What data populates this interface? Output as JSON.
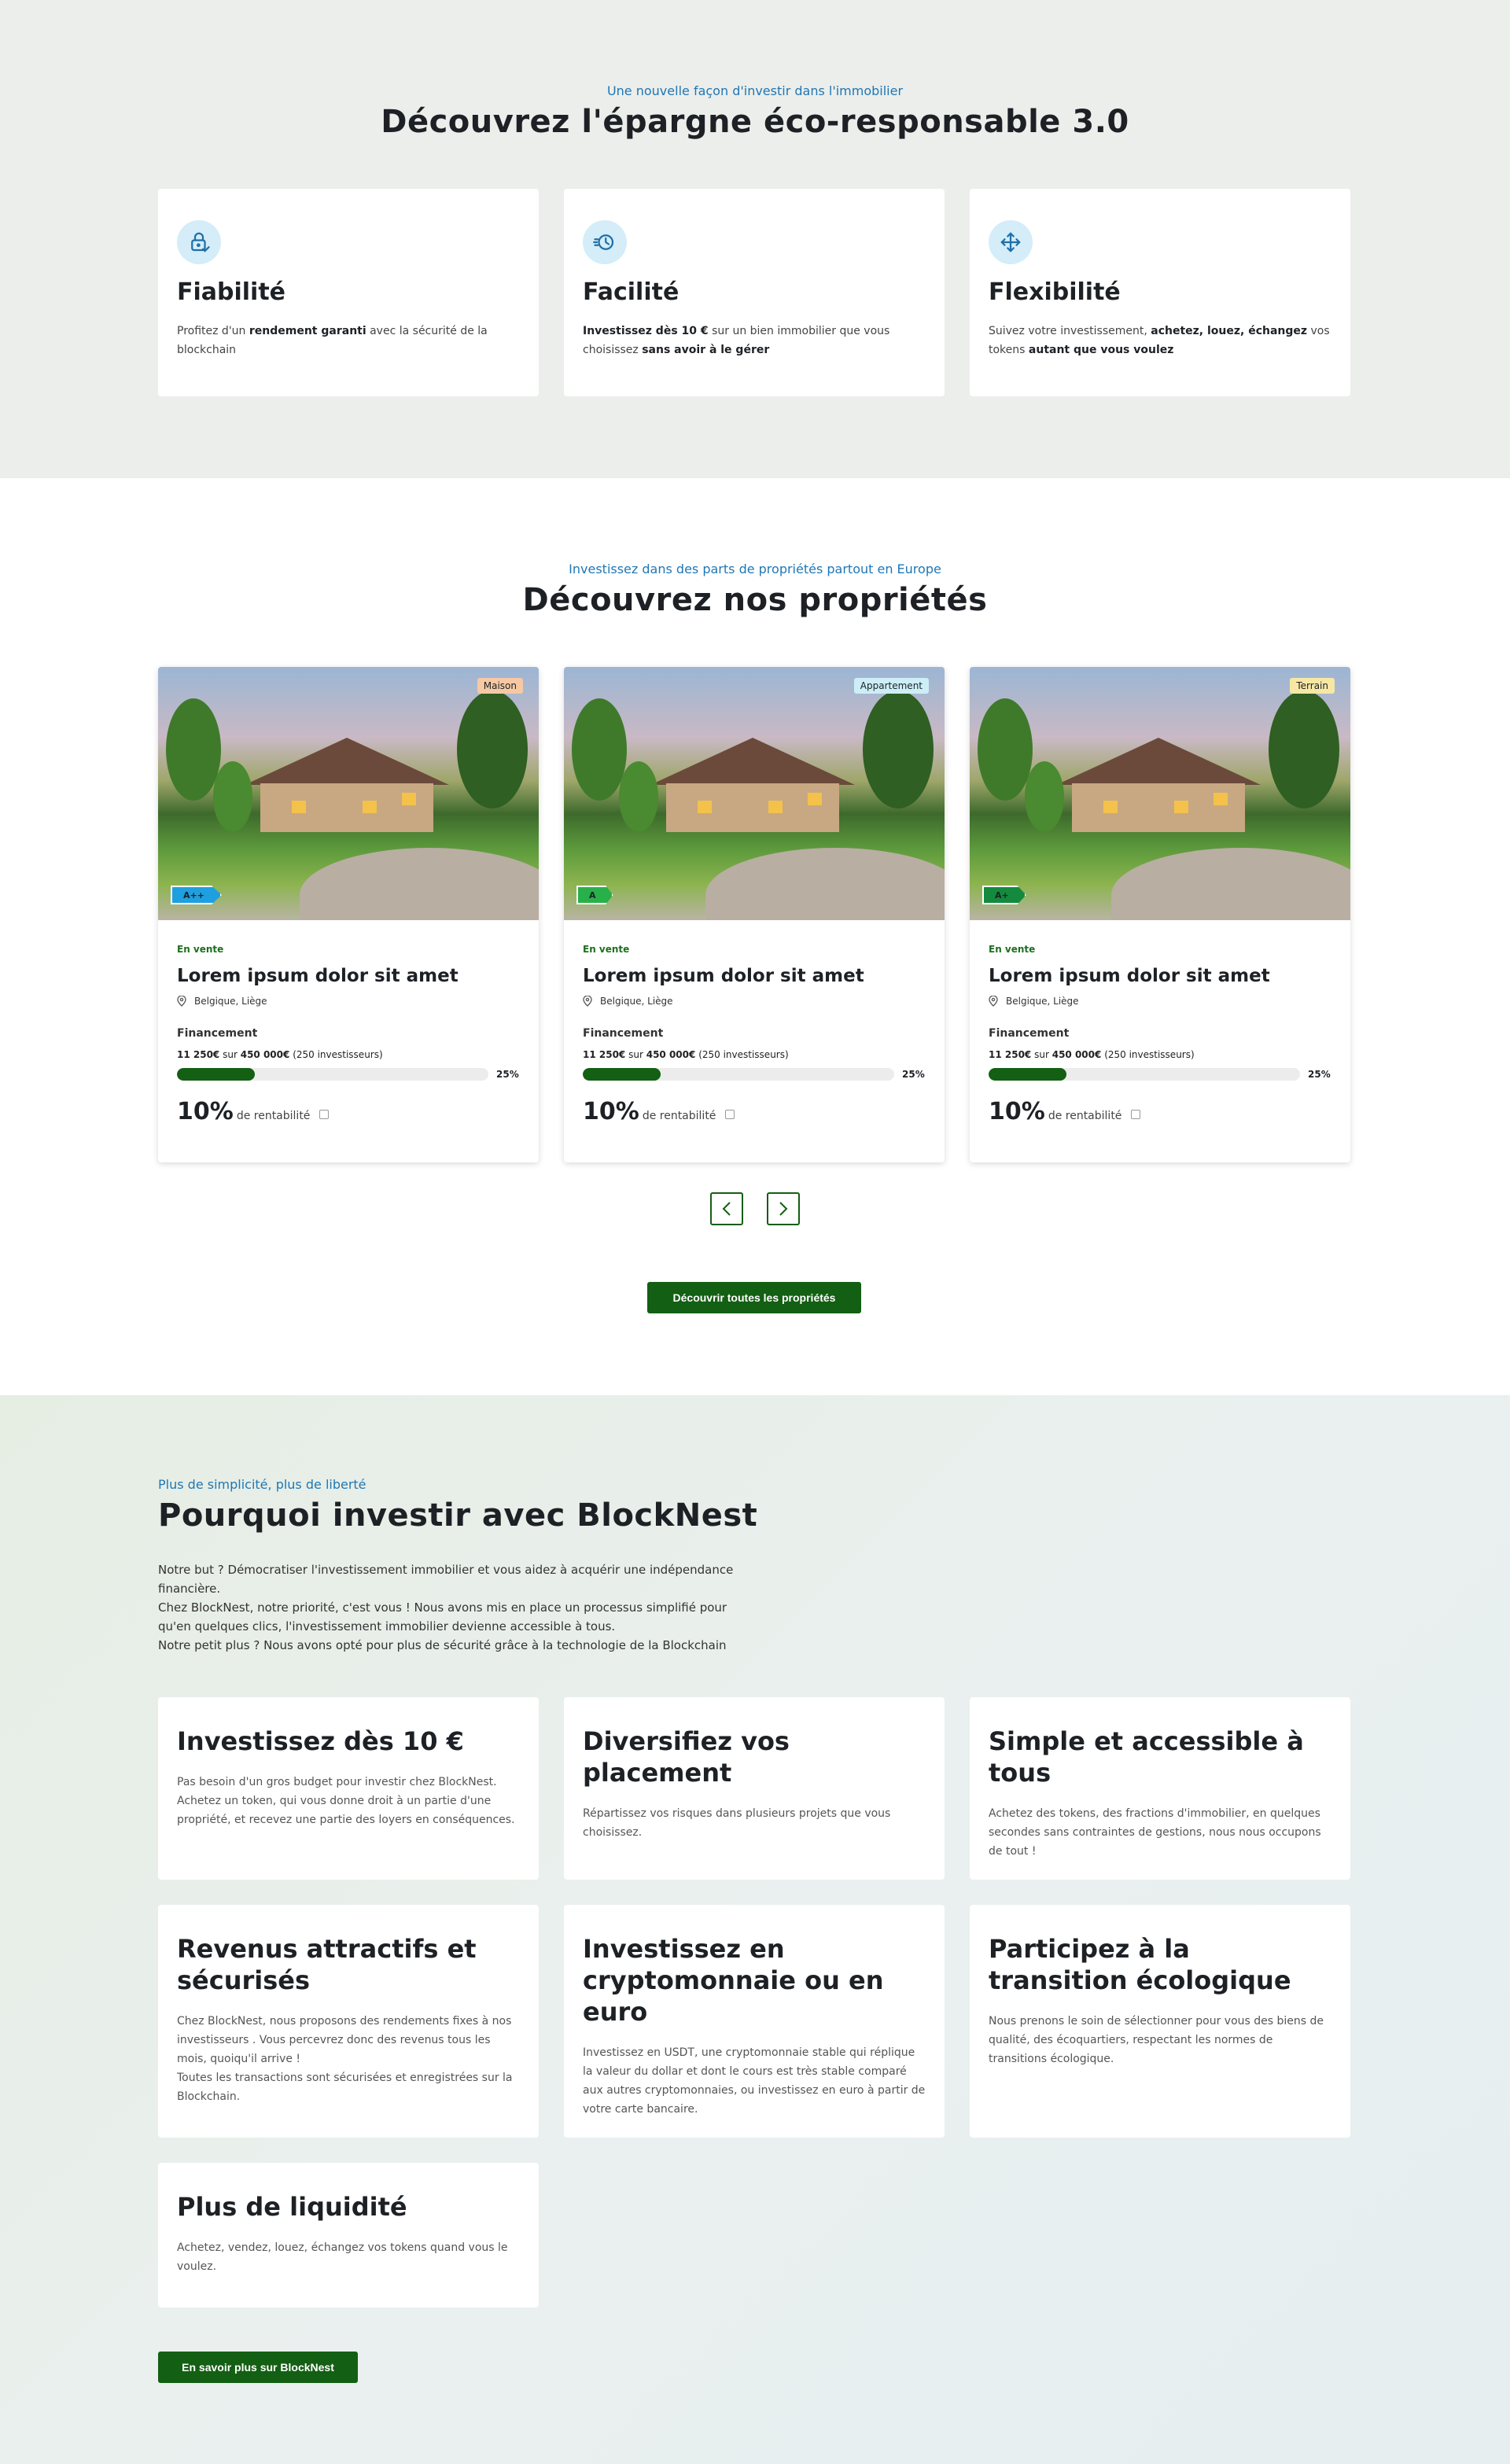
{
  "section1": {
    "eyebrow": "Une nouvelle façon d'investir dans l'immobilier",
    "title": "Découvrez l'épargne éco-responsable 3.0",
    "features": [
      {
        "icon": "lock-check-icon",
        "title": "Fiabilité",
        "text_pre": "Profitez d'un ",
        "text_bold1": "rendement garanti",
        "text_mid": " avec la sécurité de la blockchain",
        "text_bold2": "",
        "text_end": ""
      },
      {
        "icon": "clock-icon",
        "title": "Facilité",
        "text_pre": "",
        "text_bold1": "Investissez dès 10 €",
        "text_mid": " sur un bien immobilier que vous choisissez ",
        "text_bold2": "sans avoir à le gérer",
        "text_end": ""
      },
      {
        "icon": "move-arrows-icon",
        "title": "Flexibilité",
        "text_pre": "Suivez votre investissement, ",
        "text_bold1": "achetez, louez, échangez",
        "text_mid": " vos tokens ",
        "text_bold2": "autant que vous voulez",
        "text_end": ""
      }
    ]
  },
  "section2": {
    "eyebrow": "Investissez dans des parts de propriétés partout en Europe",
    "title": "Découvrez nos propriétés",
    "properties": [
      {
        "tag": "Maison",
        "tag_color": "#f6c9a4",
        "energy": "A++",
        "energy_color": "#1ea0e0",
        "status": "En vente",
        "title": "Lorem ipsum dolor sit amet",
        "location": "Belgique, Liège",
        "financing_label": "Financement",
        "raised": "11 250€",
        "sur": "sur",
        "target": "450 000€",
        "investors": "(250 investisseurs)",
        "progress": 0.25,
        "progress_label": "25%",
        "return_value": "10%",
        "return_label": "de rentabilité"
      },
      {
        "tag": "Appartement",
        "tag_color": "#cdeef6",
        "energy": "A",
        "energy_color": "#28b04a",
        "status": "En vente",
        "title": "Lorem ipsum dolor sit amet",
        "location": "Belgique, Liège",
        "financing_label": "Financement",
        "raised": "11 250€",
        "sur": "sur",
        "target": "450 000€",
        "investors": "(250 investisseurs)",
        "progress": 0.25,
        "progress_label": "25%",
        "return_value": "10%",
        "return_label": "de rentabilité"
      },
      {
        "tag": "Terrain",
        "tag_color": "#f6e7a4",
        "energy": "A+",
        "energy_color": "#138a3e",
        "status": "En vente",
        "title": "Lorem ipsum dolor sit amet",
        "location": "Belgique, Liège",
        "financing_label": "Financement",
        "raised": "11 250€",
        "sur": "sur",
        "target": "450 000€",
        "investors": "(250 investisseurs)",
        "progress": 0.25,
        "progress_label": "25%",
        "return_value": "10%",
        "return_label": "de rentabilité"
      }
    ],
    "prev_icon": "chevron-left-icon",
    "next_icon": "chevron-right-icon",
    "cta": "Découvrir toutes les propriétés"
  },
  "section3": {
    "eyebrow": "Plus de simplicité, plus de liberté",
    "title": "Pourquoi investir avec BlockNest",
    "intro": [
      "Notre but ? Démocratiser l'investissement immobilier et vous aidez à acquérir une indépendance financière.",
      "Chez BlockNest, notre priorité, c'est vous ! Nous avons mis en place un processus simplifié pour qu'en quelques clics, l'investissement immobilier devienne accessible à tous.",
      "Notre petit plus ? Nous avons opté pour plus de sécurité grâce à la technologie de la Blockchain"
    ],
    "cards": [
      {
        "title": "Investissez dès  10 €",
        "text": [
          "Pas besoin d'un gros budget pour investir chez BlockNest. Achetez un token, qui vous donne droit à un partie d'une propriété, et recevez une partie des loyers en conséquences."
        ]
      },
      {
        "title": "Diversifiez vos placement",
        "text": [
          "Répartissez vos risques dans plusieurs projets que vous choisissez."
        ]
      },
      {
        "title": "Simple et accessible à tous",
        "text": [
          "Achetez des tokens, des fractions d'immobilier, en quelques secondes sans contraintes de gestions, nous nous occupons de tout !"
        ]
      },
      {
        "title": "Revenus attractifs et sécurisés",
        "text": [
          "Chez BlockNest, nous proposons des rendements fixes à nos investisseurs . Vous percevrez donc des revenus tous les mois, quoiqu'il arrive !",
          "Toutes les transactions sont sécurisées et enregistrées sur la Blockchain."
        ]
      },
      {
        "title": "Investissez en cryptomonnaie ou en euro",
        "text": [
          "Investissez en USDT, une cryptomonnaie stable qui réplique la valeur du dollar et dont le cours est très stable comparé aux autres cryptomonnaies, ou investissez en euro à partir de votre carte bancaire."
        ]
      },
      {
        "title": "Participez à la transition écologique",
        "text": [
          "Nous prenons le soin de sélectionner pour vous des biens de qualité, des écoquartiers, respectant les normes de transitions écologique."
        ]
      },
      {
        "title": "Plus de liquidité",
        "text": [
          "Achetez, vendez, louez, échangez vos tokens quand vous le voulez."
        ]
      }
    ],
    "cta": "En savoir plus sur BlockNest"
  },
  "colors": {
    "brand_green": "#135f13",
    "accent_blue": "#1f77b4",
    "icon_bg": "#d4edf8"
  }
}
